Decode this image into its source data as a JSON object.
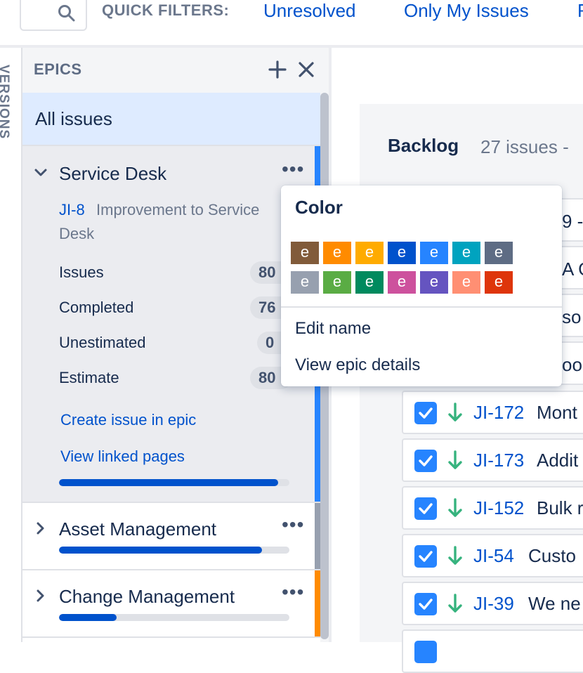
{
  "quick_filters": {
    "label": "QUICK FILTERS:",
    "links": [
      "Unresolved",
      "Only My Issues",
      "R"
    ]
  },
  "versions_tab": "VERSIONS",
  "epics_panel": {
    "header": "EPICS",
    "add_icon": "plus-icon",
    "close_icon": "close-icon",
    "all_issues": "All issues",
    "expanded_epic": {
      "name": "Service Desk",
      "color": "#2684ff",
      "key": "JI-8",
      "summary_line1": "Improvement to Service",
      "summary_line2": "Desk",
      "stats": [
        {
          "label": "Issues",
          "value": "80"
        },
        {
          "label": "Completed",
          "value": "76"
        },
        {
          "label": "Unestimated",
          "value": "0"
        },
        {
          "label": "Estimate",
          "value": "80"
        }
      ],
      "create_link": "Create issue in epic",
      "linked_pages_link": "View linked pages",
      "progress": 0.95
    },
    "collapsed_epics": [
      {
        "name": "Asset Management",
        "color": "#97a0af",
        "progress": 0.88
      },
      {
        "name": "Change Management",
        "color": "#ff8b00",
        "progress": 0.25
      }
    ]
  },
  "backlog": {
    "title": "Backlog",
    "count": "27 issues -",
    "partial_rows": [
      "9 -",
      "A G",
      "so",
      "oo"
    ],
    "issues": [
      {
        "key": "JI-172",
        "summary": "Mont"
      },
      {
        "key": "JI-173",
        "summary": "Addit"
      },
      {
        "key": "JI-152",
        "summary": "Bulk r"
      },
      {
        "key": "JI-54",
        "summary": "Custo"
      },
      {
        "key": "JI-39",
        "summary": "We ne"
      }
    ]
  },
  "color_menu": {
    "title": "Color",
    "swatch_label": "e",
    "swatches": [
      "#815b3a",
      "#ff8b00",
      "#ffab00",
      "#0052cc",
      "#2684ff",
      "#00a3bf",
      "#5e6c84",
      "#97a0af",
      "#5aac44",
      "#008a5e",
      "#cd519d",
      "#6554c0",
      "#ff8f73",
      "#de350b"
    ],
    "items": [
      "Edit name",
      "View epic details"
    ]
  }
}
